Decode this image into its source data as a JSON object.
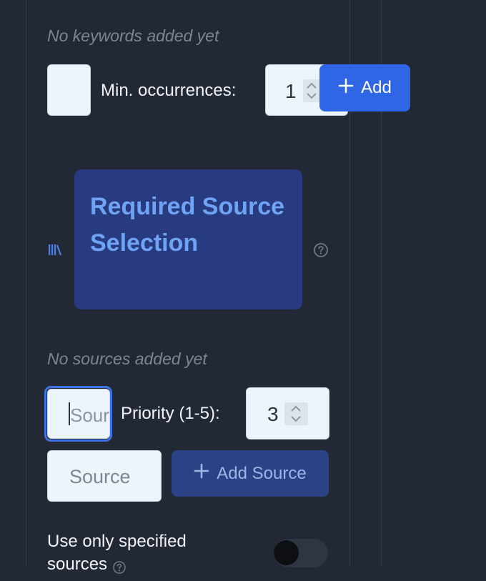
{
  "keywords": {
    "empty_text": "No keywords added yet",
    "min_label": "Min. occurrences:",
    "min_value": "1",
    "add_label": "Add"
  },
  "sources": {
    "icon": "library-icon",
    "title": "Required Source Selection",
    "help_icon": "help-circle-icon",
    "empty_text": "No sources added yet",
    "name_placeholder": "Source",
    "priority_label": "Priority (1-5):",
    "priority_value": "3",
    "source_placeholder": "Source",
    "add_source_label": "Add Source",
    "toggle_label": "Use only specified sources",
    "toggle_on": false
  },
  "colors": {
    "background": "#222935",
    "primary": "#2f66e6",
    "section_card": "#283a80",
    "section_title": "#6fa3f3"
  }
}
